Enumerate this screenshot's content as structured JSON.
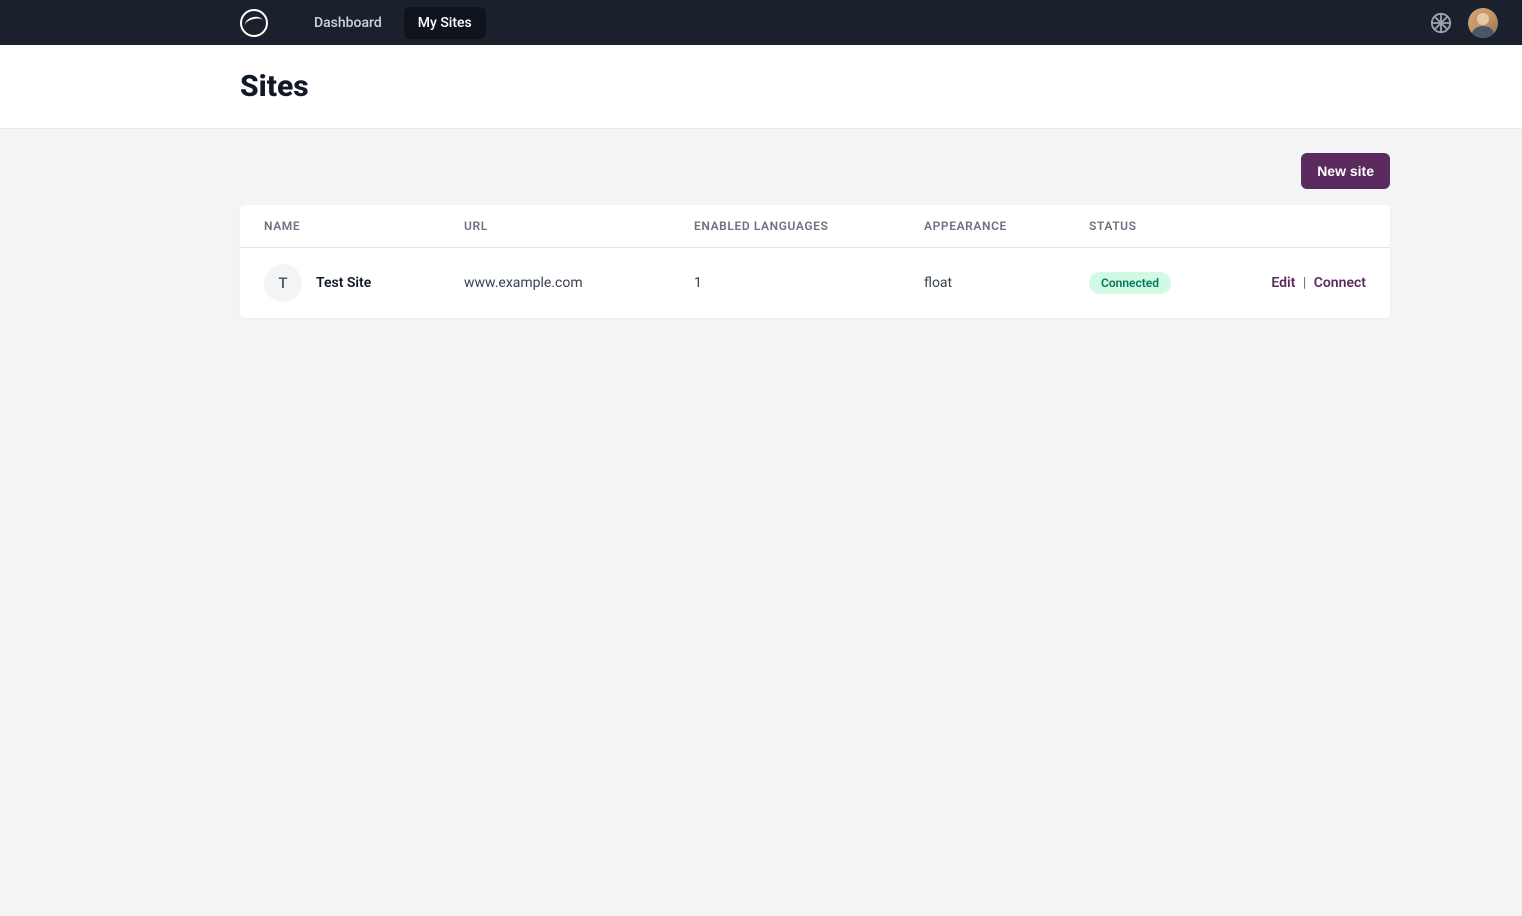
{
  "nav": {
    "dashboard": "Dashboard",
    "my_sites": "My Sites"
  },
  "page": {
    "title": "Sites"
  },
  "actions": {
    "new_site": "New site"
  },
  "table": {
    "headers": {
      "name": "NAME",
      "url": "URL",
      "enabled_languages": "ENABLED LANGUAGES",
      "appearance": "APPEARANCE",
      "status": "STATUS"
    },
    "rows": [
      {
        "avatar_letter": "T",
        "name": "Test Site",
        "url": "www.example.com",
        "enabled_languages": "1",
        "appearance": "float",
        "status": "Connected",
        "edit_label": "Edit",
        "connect_label": "Connect"
      }
    ]
  }
}
